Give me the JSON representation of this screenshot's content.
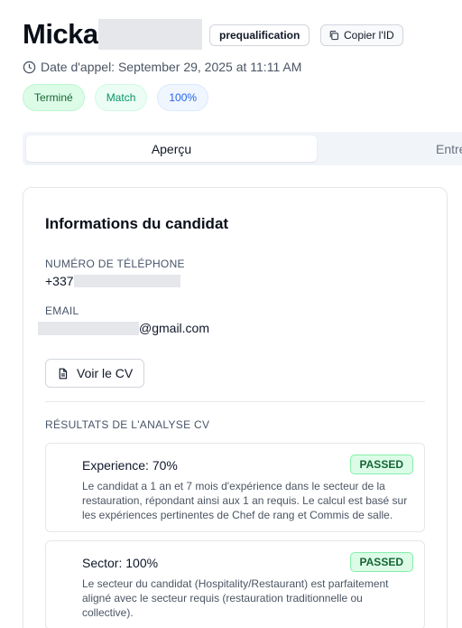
{
  "header": {
    "name": "Micka",
    "type_badge": "prequalification",
    "copy_label": "Copier l'ID",
    "date": "Date d'appel: September 29, 2025 at 11:11 AM"
  },
  "badges": {
    "status": "Terminé",
    "match": "Match",
    "score": "100%"
  },
  "tabs": [
    {
      "label": "Aperçu",
      "active": true
    },
    {
      "label": "Entre",
      "active": false
    }
  ],
  "candidate": {
    "title": "Informations du candidat",
    "phone_label": "NUMÉRO DE TÉLÉPHONE",
    "phone_prefix": "+337",
    "email_label": "EMAIL",
    "email_suffix": "@gmail.com",
    "cv_button": "Voir le CV",
    "analysis_label": "RÉSULTATS DE L'ANALYSE CV"
  },
  "results": [
    {
      "title": "Experience: 70%",
      "status": "PASSED",
      "description": "Le candidat a 1 an et 7 mois d'expérience dans le secteur de la restauration, répondant ainsi aux 1 an requis. Le calcul est basé sur les expériences pertinentes de Chef de rang et Commis de salle."
    },
    {
      "title": "Sector: 100%",
      "status": "PASSED",
      "description": "Le secteur du candidat (Hospitality/Restaurant) est parfaitement aligné avec le secteur requis (restauration traditionnelle ou collective)."
    }
  ],
  "colors": {
    "passed_bg": "#dcfce7",
    "passed_text": "#166534",
    "score_text": "#2563eb"
  }
}
